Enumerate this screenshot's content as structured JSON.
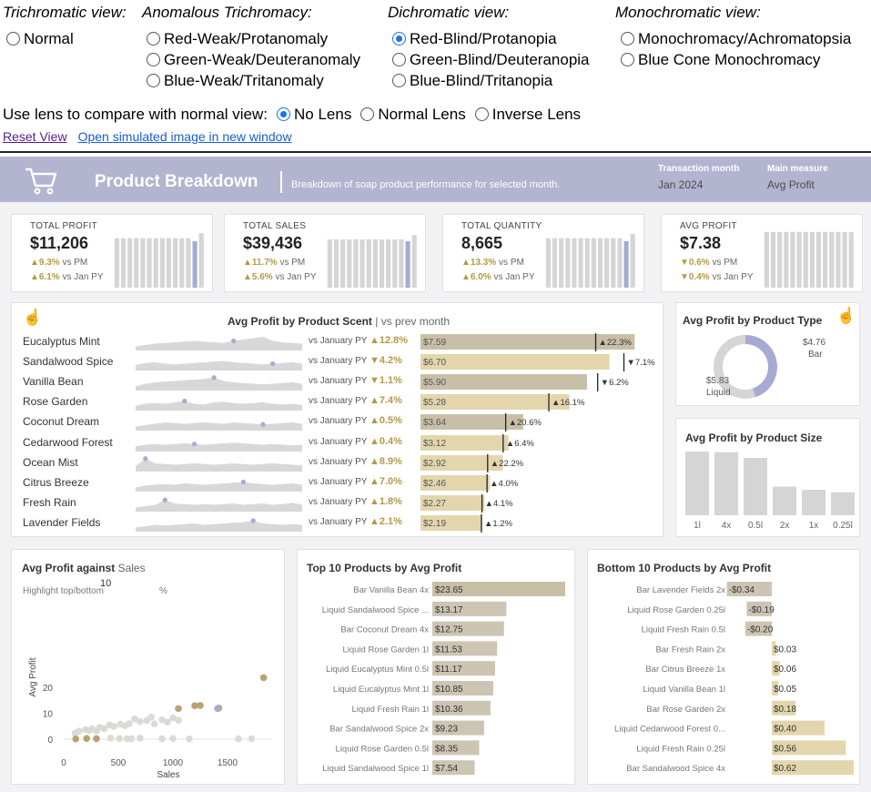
{
  "simulator": {
    "trichromatic": {
      "heading": "Trichromatic view:",
      "options": [
        "Normal"
      ]
    },
    "anomalous": {
      "heading": "Anomalous Trichromacy:",
      "options": [
        "Red-Weak/Protanomaly",
        "Green-Weak/Deuteranomaly",
        "Blue-Weak/Tritanomaly"
      ]
    },
    "dichromatic": {
      "heading": "Dichromatic view:",
      "options": [
        "Red-Blind/Protanopia",
        "Green-Blind/Deuteranopia",
        "Blue-Blind/Tritanopia"
      ],
      "selected": "Red-Blind/Protanopia"
    },
    "monochromatic": {
      "heading": "Monochromatic view:",
      "options": [
        "Monochromacy/Achromatopsia",
        "Blue Cone Monochromacy"
      ]
    },
    "lens": {
      "label": "Use lens to compare with normal view:",
      "options": [
        "No Lens",
        "Normal Lens",
        "Inverse Lens"
      ],
      "selected": "No Lens"
    },
    "links": {
      "reset": "Reset View",
      "open": "Open simulated image in new window"
    }
  },
  "dashboard": {
    "title": "Product Breakdown",
    "subtitle": "Breakdown of soap product performance for selected month.",
    "transaction_month": {
      "label": "Transaction month",
      "value": "Jan 2024"
    },
    "main_measure": {
      "label": "Main measure",
      "value": "Avg Profit"
    },
    "kpis": [
      {
        "label": "TOTAL PROFIT",
        "value": "$11,206",
        "pm_delta": "▲9.3%",
        "pm_text": "vs PM",
        "py_delta": "▲6.1%",
        "py_text": "vs Jan PY",
        "bars": [
          0.8,
          0.8,
          0.8,
          0.8,
          0.8,
          0.8,
          0.8,
          0.8,
          0.8,
          0.8,
          0.8,
          0.8,
          0.75,
          0.88
        ]
      },
      {
        "label": "TOTAL SALES",
        "value": "$39,436",
        "pm_delta": "▲11.7%",
        "pm_text": "vs PM",
        "py_delta": "▲5.6%",
        "py_text": "vs Jan PY",
        "bars": [
          0.78,
          0.78,
          0.78,
          0.78,
          0.78,
          0.78,
          0.78,
          0.78,
          0.78,
          0.78,
          0.78,
          0.78,
          0.75,
          0.85
        ]
      },
      {
        "label": "TOTAL QUANTITY",
        "value": "8,665",
        "pm_delta": "▲13.3%",
        "pm_text": "vs PM",
        "py_delta": "▲6.0%",
        "py_text": "vs Jan PY",
        "bars": [
          0.8,
          0.8,
          0.8,
          0.8,
          0.8,
          0.8,
          0.8,
          0.8,
          0.8,
          0.8,
          0.8,
          0.8,
          0.75,
          0.87
        ]
      },
      {
        "label": "AVG PROFIT",
        "value": "$7.38",
        "pm_delta": "▼0.6%",
        "pm_text": "vs PM",
        "py_delta": "▼0.4%",
        "py_text": "vs Jan PY",
        "bars": [
          0.9,
          0.9,
          0.9,
          0.9,
          0.9,
          0.9,
          0.9,
          0.9,
          0.9,
          0.9,
          0.9,
          0.9,
          0.9,
          0.9
        ]
      }
    ],
    "scent": {
      "title": "Avg Profit by Product Scent",
      "subtitle": "vs prev month",
      "vs_label": "vs January PY",
      "rows": [
        {
          "name": "Eucalyptus Mint",
          "pct": "▲12.8%",
          "value": 7.59,
          "label": "$7.59",
          "py_marker": 6.21,
          "py_label": "▲22.3%"
        },
        {
          "name": "Sandalwood Spice",
          "pct": "▼4.2%",
          "value": 6.7,
          "label": "$6.70",
          "py_marker": 7.21,
          "py_label": "▼7.1%"
        },
        {
          "name": "Vanilla Bean",
          "pct": "▼1.1%",
          "value": 5.9,
          "label": "$5.90",
          "py_marker": 6.28,
          "py_label": "▼6.2%"
        },
        {
          "name": "Rose Garden",
          "pct": "▲7.4%",
          "value": 5.28,
          "label": "$5.28",
          "py_marker": 4.55,
          "py_label": "▲16.1%"
        },
        {
          "name": "Coconut Dream",
          "pct": "▲0.5%",
          "value": 3.64,
          "label": "$3.64",
          "py_marker": 3.02,
          "py_label": "▲20.6%"
        },
        {
          "name": "Cedarwood Forest",
          "pct": "▲0.4%",
          "value": 3.12,
          "label": "$3.12",
          "py_marker": 2.93,
          "py_label": "▲6.4%"
        },
        {
          "name": "Ocean Mist",
          "pct": "▲8.9%",
          "value": 2.92,
          "label": "$2.92",
          "py_marker": 2.38,
          "py_label": "▲22.2%"
        },
        {
          "name": "Citrus Breeze",
          "pct": "▲7.0%",
          "value": 2.46,
          "label": "$2.46",
          "py_marker": 2.36,
          "py_label": "▲4.0%"
        },
        {
          "name": "Fresh Rain",
          "pct": "▲1.8%",
          "value": 2.27,
          "label": "$2.27",
          "py_marker": 2.18,
          "py_label": "▲4.1%"
        },
        {
          "name": "Lavender Fields",
          "pct": "▲2.1%",
          "value": 2.19,
          "label": "$2.19",
          "py_marker": 2.16,
          "py_label": "▲1.2%"
        }
      ],
      "sparklines": [
        [
          0.3,
          0.4,
          0.5,
          0.55,
          0.6,
          0.65,
          0.7,
          0.65,
          0.6,
          0.55,
          0.7,
          0.8,
          0.9,
          1.0,
          0.7,
          0.6,
          0.55,
          0.5
        ],
        [
          0.4,
          0.55,
          0.6,
          0.5,
          0.45,
          0.5,
          0.55,
          0.6,
          0.65,
          0.7,
          0.6,
          0.55,
          0.5,
          0.45,
          0.5,
          0.55,
          0.6,
          0.5
        ],
        [
          0.3,
          0.5,
          0.6,
          0.65,
          0.7,
          0.75,
          0.8,
          0.85,
          0.95,
          0.7,
          0.6,
          0.55,
          0.5,
          0.45,
          0.5,
          0.55,
          0.6,
          0.5
        ],
        [
          0.35,
          0.5,
          0.55,
          0.5,
          0.6,
          0.7,
          0.5,
          0.45,
          0.6,
          0.65,
          0.55,
          0.5,
          0.55,
          0.6,
          0.5,
          0.45,
          0.5,
          0.4
        ],
        [
          0.3,
          0.4,
          0.5,
          0.6,
          0.55,
          0.5,
          0.55,
          0.6,
          0.55,
          0.5,
          0.6,
          0.55,
          0.5,
          0.45,
          0.5,
          0.55,
          0.6,
          0.5
        ],
        [
          0.4,
          0.5,
          0.55,
          0.5,
          0.55,
          0.6,
          0.55,
          0.5,
          0.55,
          0.6,
          0.65,
          0.6,
          0.55,
          0.5,
          0.55,
          0.5,
          0.45,
          0.5
        ],
        [
          0.4,
          0.95,
          0.6,
          0.55,
          0.5,
          0.55,
          0.6,
          0.55,
          0.5,
          0.55,
          0.6,
          0.55,
          0.5,
          0.55,
          0.6,
          0.55,
          0.5,
          0.45
        ],
        [
          0.3,
          0.45,
          0.5,
          0.55,
          0.5,
          0.6,
          0.55,
          0.5,
          0.55,
          0.6,
          0.65,
          0.7,
          0.6,
          0.55,
          0.5,
          0.55,
          0.6,
          0.5
        ],
        [
          0.3,
          0.4,
          0.5,
          0.85,
          0.6,
          0.55,
          0.5,
          0.55,
          0.5,
          0.55,
          0.6,
          0.5,
          0.55,
          0.6,
          0.5,
          0.55,
          0.65,
          0.5
        ],
        [
          0.3,
          0.4,
          0.5,
          0.45,
          0.5,
          0.55,
          0.6,
          0.5,
          0.55,
          0.6,
          0.65,
          0.7,
          0.8,
          0.6,
          0.55,
          0.5,
          0.55,
          0.5
        ]
      ],
      "highlight_points": [
        10,
        14,
        8,
        5,
        13,
        6,
        1,
        11,
        3,
        12
      ]
    },
    "product_type": {
      "title": "Avg Profit by Product Type",
      "slices": [
        {
          "name": "Bar",
          "label": "$4.76",
          "value": 4.76,
          "color": "#a7aad2"
        },
        {
          "name": "Liquid",
          "label": "$5.83",
          "value": 5.83,
          "color": "#d5d5d5"
        }
      ]
    },
    "product_size": {
      "title": "Avg Profit by Product Size",
      "categories": [
        "1l",
        "4x",
        "0.5l",
        "2x",
        "1x",
        "0.25l"
      ],
      "values": [
        1.0,
        0.99,
        0.9,
        0.45,
        0.4,
        0.36
      ]
    },
    "scatter": {
      "title": "Avg Profit against",
      "title_sales": "Sales",
      "highlight_label": "Highlight top/bottom",
      "highlight_value": "10",
      "highlight_suffix": "%",
      "xlabel": "Sales",
      "ylabel": "Avg Profit",
      "xticks": [
        "0",
        "500",
        "1000",
        "1500"
      ],
      "yticks": [
        "0",
        "10",
        "20"
      ],
      "points_gray": [
        [
          105,
          2.3
        ],
        [
          140,
          3.1
        ],
        [
          200,
          3.7
        ],
        [
          230,
          3.4
        ],
        [
          260,
          4.0
        ],
        [
          300,
          3.2
        ],
        [
          330,
          4.6
        ],
        [
          370,
          4.0
        ],
        [
          420,
          5.5
        ],
        [
          460,
          4.9
        ],
        [
          520,
          5.8
        ],
        [
          560,
          5.2
        ],
        [
          600,
          6.0
        ],
        [
          650,
          7.8
        ],
        [
          700,
          6.8
        ],
        [
          760,
          7.2
        ],
        [
          800,
          8.5
        ],
        [
          830,
          5.9
        ],
        [
          900,
          7.5
        ],
        [
          950,
          6.6
        ],
        [
          1000,
          8.2
        ],
        [
          1050,
          7.3
        ],
        [
          430,
          0.4
        ],
        [
          510,
          0.3
        ],
        [
          580,
          0.2
        ],
        [
          620,
          0.2
        ],
        [
          700,
          0.4
        ],
        [
          900,
          0.2
        ],
        [
          1000,
          0.3
        ],
        [
          1150,
          0.1
        ],
        [
          1600,
          0.1
        ],
        [
          1720,
          0.2
        ]
      ],
      "points_gold": [
        [
          1050,
          11.8
        ],
        [
          1200,
          12.9
        ],
        [
          1250,
          13.0
        ],
        [
          1420,
          12.0
        ],
        [
          1830,
          23.7
        ],
        [
          110,
          0.1
        ],
        [
          210,
          0.3
        ],
        [
          300,
          0.2
        ]
      ],
      "points_purple": [
        [
          1410,
          11.8
        ]
      ]
    },
    "top10": {
      "title": "Top 10 Products by Avg Profit",
      "labels": [
        "Bar Vanilla Bean 4x",
        "Liquid Sandalwood Spice ...",
        "Bar Coconut Dream 4x",
        "Liquid Rose Garden 1l",
        "Liquid Eucalyptus Mint 0.5l",
        "Liquid Eucalyptus Mint 1l",
        "Liquid Fresh Rain 1l",
        "Bar Sandalwood Spice 2x",
        "Liquid Rose Garden 0.5l",
        "Liquid Sandalwood Spice 1l"
      ],
      "values": [
        23.65,
        13.17,
        12.75,
        11.53,
        11.17,
        10.85,
        10.36,
        9.23,
        8.35,
        7.54
      ],
      "value_labels": [
        "$23.65",
        "$13.17",
        "$12.75",
        "$11.53",
        "$11.17",
        "$10.85",
        "$10.36",
        "$9.23",
        "$8.35",
        "$7.54"
      ]
    },
    "bottom10": {
      "title": "Bottom 10 Products by Avg Profit",
      "labels": [
        "Bar Lavender Fields 2x",
        "Liquid Rose Garden 0.25l",
        "Liquid Fresh Rain 0.5l",
        "Bar Fresh Rain 2x",
        "Bar Citrus Breeze 1x",
        "Liquid Vanilla Bean 1l",
        "Bar Rose Garden 2x",
        "Liquid Cedarwood Forest 0...",
        "Liquid Fresh Rain 0.25l",
        "Bar Sandalwood Spice 4x"
      ],
      "values": [
        -0.34,
        -0.19,
        -0.2,
        0.03,
        0.06,
        0.05,
        0.18,
        0.4,
        0.56,
        0.62
      ],
      "value_labels": [
        "-$0.34",
        "-$0.19",
        "-$0.20",
        "$0.03",
        "$0.06",
        "$0.05",
        "$0.18",
        "$0.40",
        "$0.56",
        "$0.62"
      ]
    }
  },
  "chart_data": [
    {
      "type": "bar",
      "title": "Avg Profit by Product Scent",
      "categories": [
        "Eucalyptus Mint",
        "Sandalwood Spice",
        "Vanilla Bean",
        "Rose Garden",
        "Coconut Dream",
        "Cedarwood Forest",
        "Ocean Mist",
        "Citrus Breeze",
        "Fresh Rain",
        "Lavender Fields"
      ],
      "values": [
        7.59,
        6.7,
        5.9,
        5.28,
        3.64,
        3.12,
        2.92,
        2.46,
        2.27,
        2.19
      ]
    },
    {
      "type": "pie",
      "title": "Avg Profit by Product Type",
      "categories": [
        "Bar",
        "Liquid"
      ],
      "values": [
        4.76,
        5.83
      ]
    },
    {
      "type": "bar",
      "title": "Avg Profit by Product Size",
      "categories": [
        "1l",
        "4x",
        "0.5l",
        "2x",
        "1x",
        "0.25l"
      ],
      "values": [
        1.0,
        0.99,
        0.9,
        0.45,
        0.4,
        0.36
      ]
    },
    {
      "type": "scatter",
      "title": "Avg Profit against Sales",
      "xlabel": "Sales",
      "ylabel": "Avg Profit",
      "xlim": [
        0,
        2000
      ],
      "ylim": [
        0,
        25
      ]
    },
    {
      "type": "bar",
      "title": "Top 10 Products by Avg Profit",
      "categories": [
        "Bar Vanilla Bean 4x",
        "Liquid Sandalwood Spice ...",
        "Bar Coconut Dream 4x",
        "Liquid Rose Garden 1l",
        "Liquid Eucalyptus Mint 0.5l",
        "Liquid Eucalyptus Mint 1l",
        "Liquid Fresh Rain 1l",
        "Bar Sandalwood Spice 2x",
        "Liquid Rose Garden 0.5l",
        "Liquid Sandalwood Spice 1l"
      ],
      "values": [
        23.65,
        13.17,
        12.75,
        11.53,
        11.17,
        10.85,
        10.36,
        9.23,
        8.35,
        7.54
      ]
    },
    {
      "type": "bar",
      "title": "Bottom 10 Products by Avg Profit",
      "categories": [
        "Bar Lavender Fields 2x",
        "Liquid Rose Garden 0.25l",
        "Liquid Fresh Rain 0.5l",
        "Bar Fresh Rain 2x",
        "Bar Citrus Breeze 1x",
        "Liquid Vanilla Bean 1l",
        "Bar Rose Garden 2x",
        "Liquid Cedarwood Forest 0...",
        "Liquid Fresh Rain 0.25l",
        "Bar Sandalwood Spice 4x"
      ],
      "values": [
        -0.34,
        -0.19,
        -0.2,
        0.03,
        0.06,
        0.05,
        0.18,
        0.4,
        0.56,
        0.62
      ]
    }
  ],
  "colors": {
    "accent": "#a7aad2",
    "header": "#b3b4cf",
    "bar_tan": "#e3d6ad",
    "bar_gray": "#cdc5b3",
    "gold": "#b39a45",
    "gray": "#d5d5d5"
  }
}
